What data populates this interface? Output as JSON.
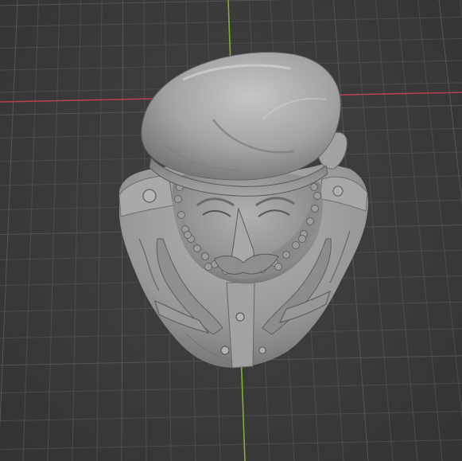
{
  "viewport": {
    "background_color": "#393939",
    "grid_color": "#4c4c4c",
    "grid_major_color": "#555555",
    "x_axis_color": "#b5434d",
    "y_axis_color": "#7fae33",
    "model": {
      "name": "bust-with-beret",
      "base_color": "#9a9a9a",
      "highlight_color": "#c9c9c9",
      "shadow_color": "#5a5a5a"
    }
  }
}
